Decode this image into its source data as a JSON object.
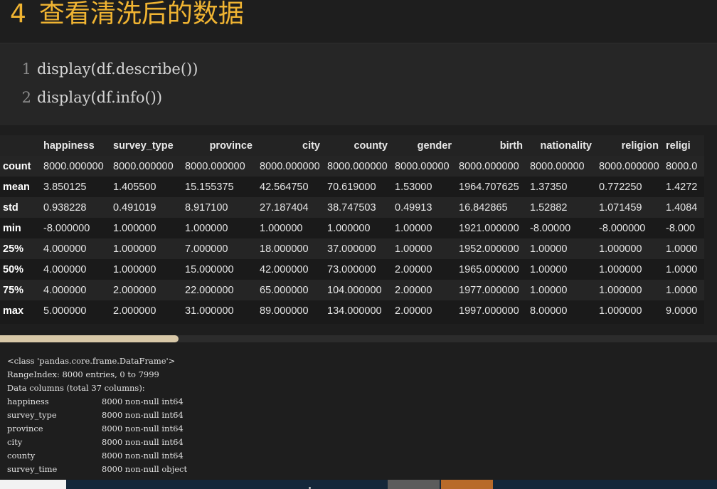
{
  "heading": {
    "number": "4",
    "title": "查看清洗后的数据"
  },
  "code": {
    "lines": [
      {
        "num": "1",
        "text": "display(df.describe())"
      },
      {
        "num": "2",
        "text": "display(df.info())"
      }
    ]
  },
  "describe_table": {
    "columns": [
      "happiness",
      "survey_type",
      "province",
      "city",
      "county",
      "gender",
      "birth",
      "nationality",
      "religion",
      "religi"
    ],
    "rows": [
      {
        "label": "count",
        "values": [
          "8000.000000",
          "8000.000000",
          "8000.000000",
          "8000.000000",
          "8000.000000",
          "8000.00000",
          "8000.000000",
          "8000.00000",
          "8000.000000",
          "8000.0"
        ]
      },
      {
        "label": "mean",
        "values": [
          "3.850125",
          "1.405500",
          "15.155375",
          "42.564750",
          "70.619000",
          "1.53000",
          "1964.707625",
          "1.37350",
          "0.772250",
          "1.4272"
        ]
      },
      {
        "label": "std",
        "values": [
          "0.938228",
          "0.491019",
          "8.917100",
          "27.187404",
          "38.747503",
          "0.49913",
          "16.842865",
          "1.52882",
          "1.071459",
          "1.4084"
        ]
      },
      {
        "label": "min",
        "values": [
          "-8.000000",
          "1.000000",
          "1.000000",
          "1.000000",
          "1.000000",
          "1.00000",
          "1921.000000",
          "-8.00000",
          "-8.000000",
          "-8.000"
        ]
      },
      {
        "label": "25%",
        "values": [
          "4.000000",
          "1.000000",
          "7.000000",
          "18.000000",
          "37.000000",
          "1.00000",
          "1952.000000",
          "1.00000",
          "1.000000",
          "1.0000"
        ]
      },
      {
        "label": "50%",
        "values": [
          "4.000000",
          "1.000000",
          "15.000000",
          "42.000000",
          "73.000000",
          "2.00000",
          "1965.000000",
          "1.00000",
          "1.000000",
          "1.0000"
        ]
      },
      {
        "label": "75%",
        "values": [
          "4.000000",
          "2.000000",
          "22.000000",
          "65.000000",
          "104.000000",
          "2.00000",
          "1977.000000",
          "1.00000",
          "1.000000",
          "1.0000"
        ]
      },
      {
        "label": "max",
        "values": [
          "5.000000",
          "2.000000",
          "31.000000",
          "89.000000",
          "134.000000",
          "2.00000",
          "1997.000000",
          "8.00000",
          "1.000000",
          "9.0000"
        ]
      }
    ]
  },
  "info_output": {
    "header_lines": [
      "<class 'pandas.core.frame.DataFrame'>",
      "RangeIndex: 8000 entries, 0 to 7999",
      "Data columns (total 37 columns):"
    ],
    "columns": [
      {
        "name": "happiness",
        "info": "8000 non-null int64"
      },
      {
        "name": "survey_type",
        "info": "8000 non-null int64"
      },
      {
        "name": "province",
        "info": "8000 non-null int64"
      },
      {
        "name": "city",
        "info": "8000 non-null int64"
      },
      {
        "name": "county",
        "info": "8000 non-null int64"
      },
      {
        "name": "survey_time",
        "info": "8000 non-null object"
      }
    ]
  },
  "colors": {
    "heading": "#f0b432",
    "background": "#1e1e1e",
    "code_background": "#262626"
  }
}
